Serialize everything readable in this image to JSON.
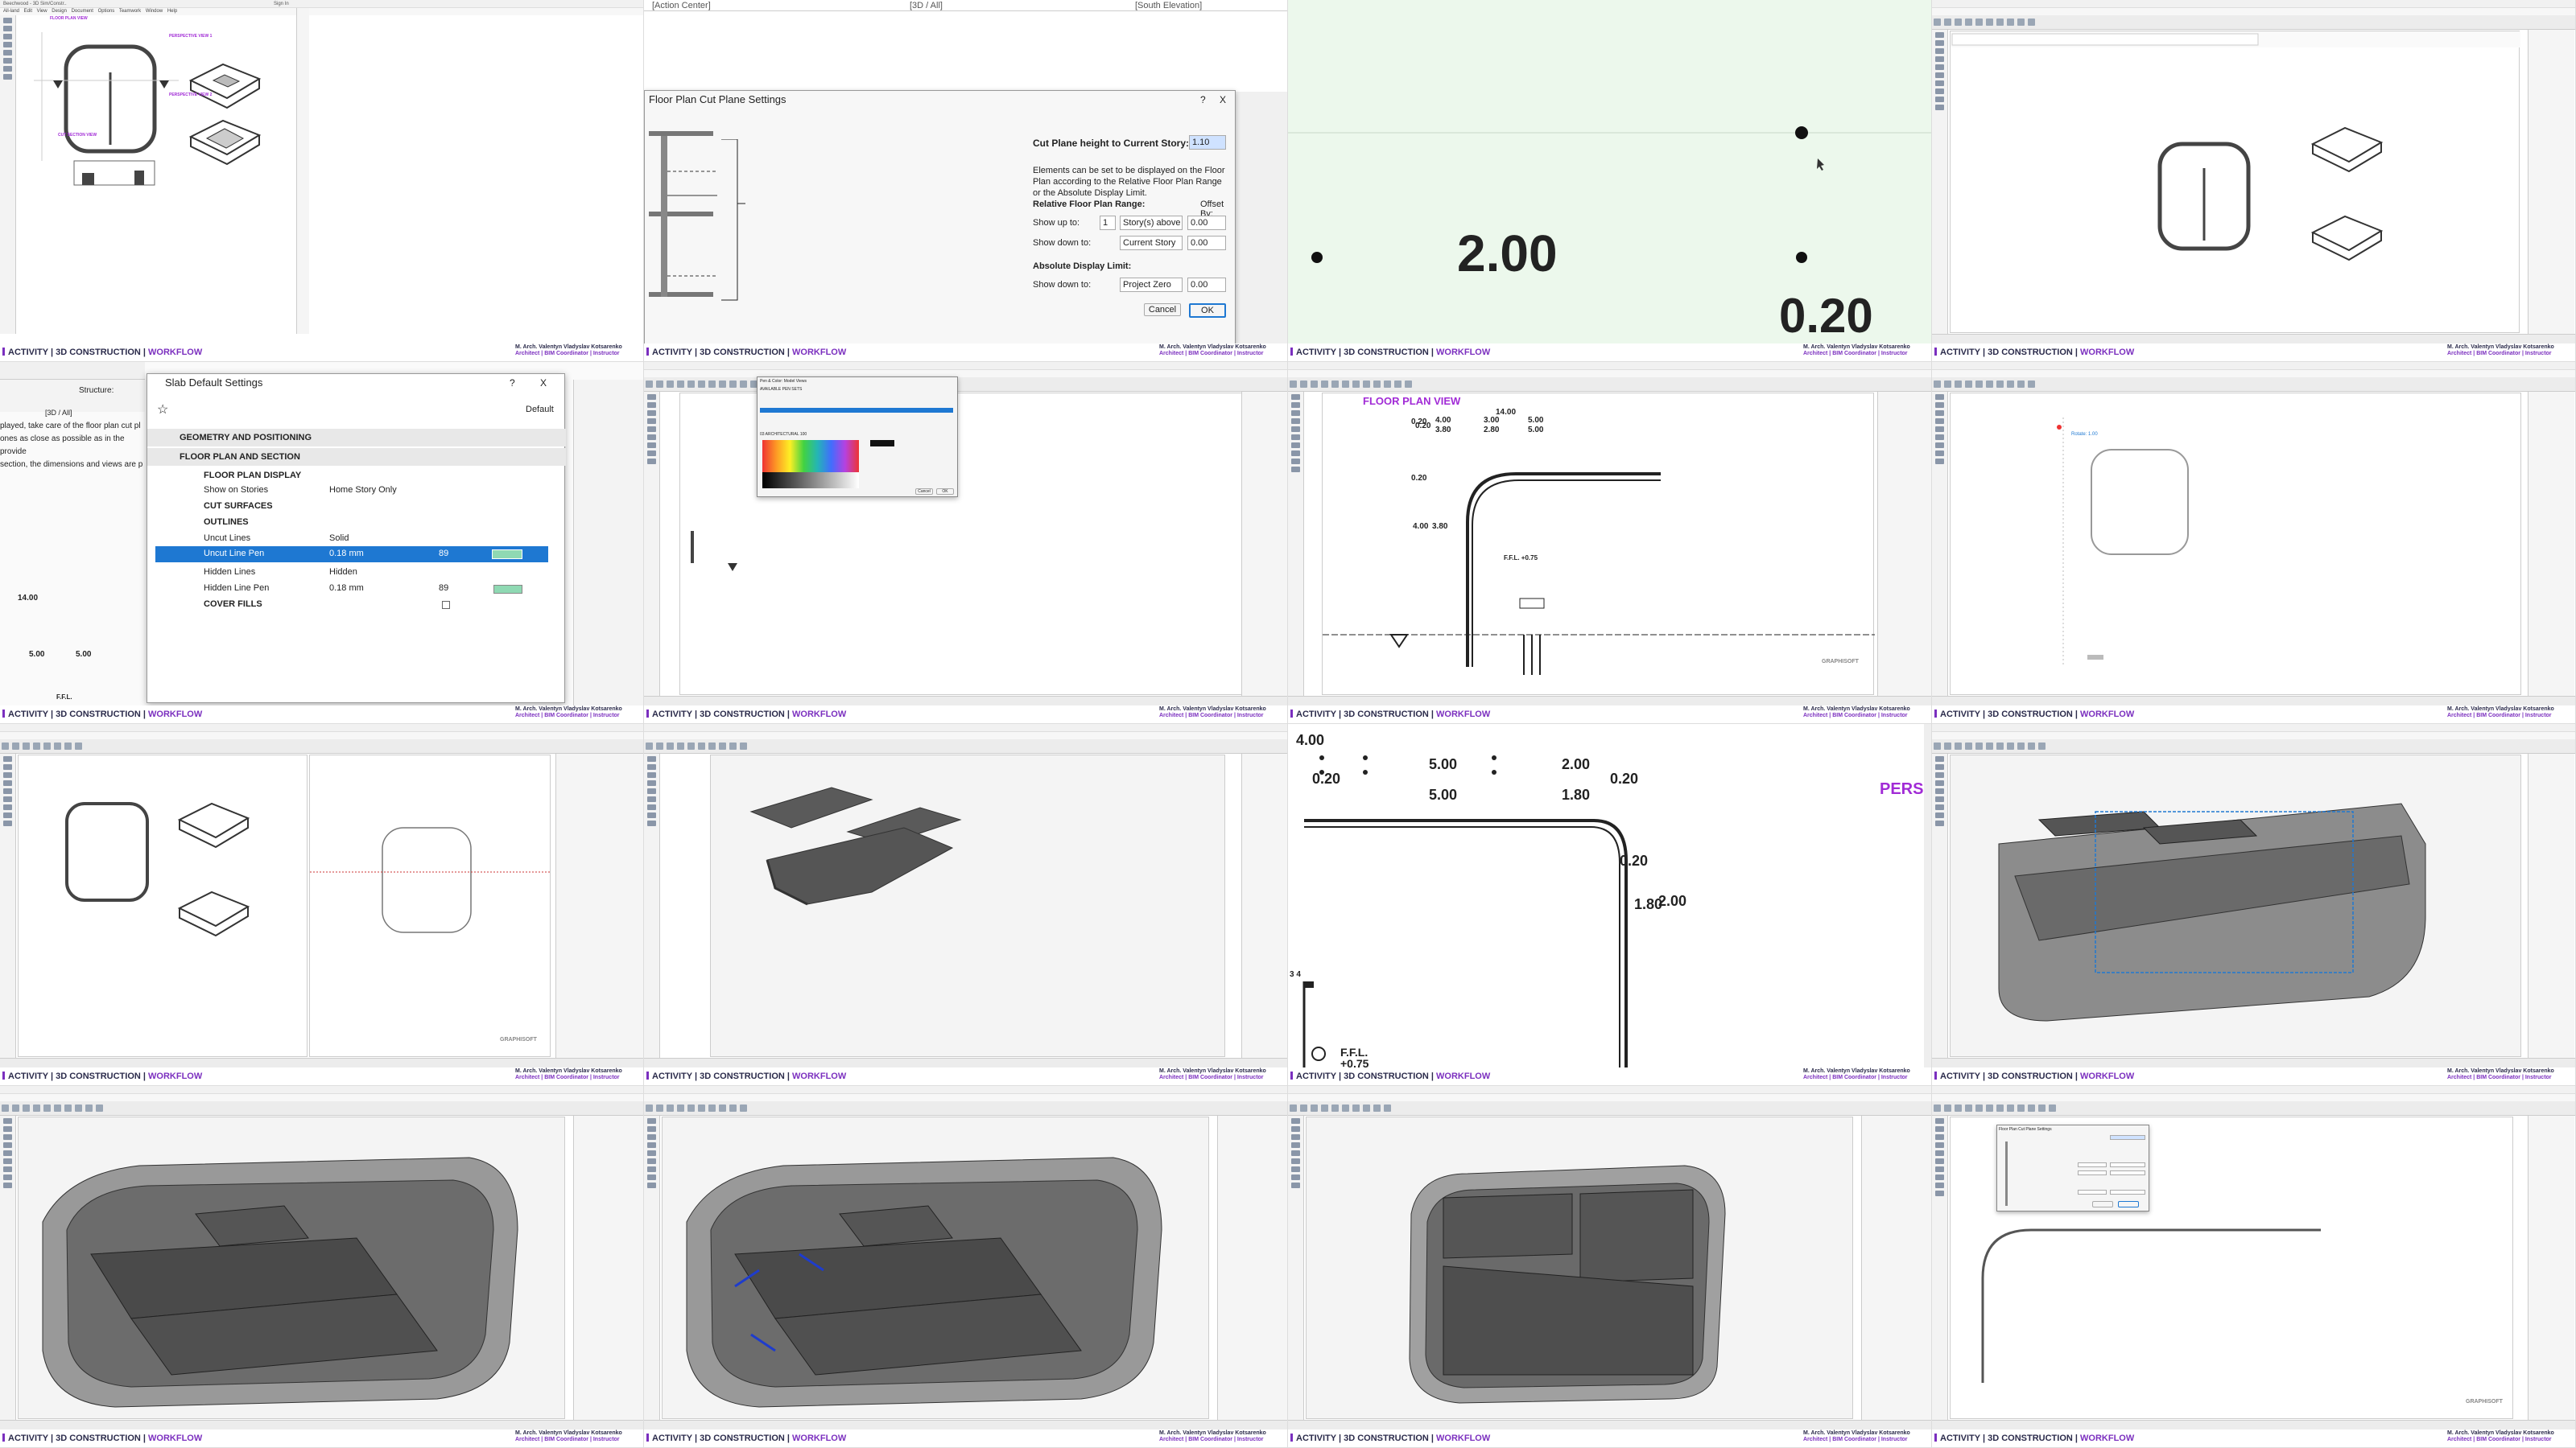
{
  "footer": {
    "activity": "ACTIVITY | 3D CONSTRUCTION |",
    "workflow": "WORKFLOW",
    "author": "M. Arch. Valentyn Vladyslav Kotsarenko",
    "role": "Architect | BIM Coordinator | Instructor"
  },
  "tile1": {
    "win_tab": "Beechwood - 3D Sim/Constr..",
    "title": "Sign In",
    "menu": "All-land  Edit  View  Design  Document  Options  Teamwork  Window  Help",
    "labels": {
      "plan": "FLOOR PLAN VIEW",
      "persp1": "PERSPECTIVE VIEW 1",
      "persp2": "PERSPECTIVE VIEW 2",
      "section": "CUT SECTION VIEW"
    }
  },
  "tile2": {
    "top_tabs": [
      "[Action Center]",
      "[3D / All]",
      "[South Elevation]"
    ],
    "title": "Floor Plan Cut Plane Settings",
    "help": "?",
    "close": "X",
    "cut_height_label": "Cut Plane height to Current Story:",
    "cut_height_value": "1.10",
    "desc": "Elements can be set to be displayed on the Floor Plan according to the Relative Floor Plan Range or the Absolute Display Limit.",
    "rel_range": "Relative Floor Plan Range:",
    "offset_by": "Offset By:",
    "show_up": "Show up to:",
    "show_up_n": "1",
    "show_up_sel": "Story(s) above",
    "show_up_val": "0.00",
    "show_down": "Show down to:",
    "show_down_sel": "Current Story",
    "show_down_val": "0.00",
    "abs_limit": "Absolute Display Limit:",
    "abs_down": "Show down to:",
    "abs_sel": "Project Zero",
    "abs_val": "0.00",
    "cancel": "Cancel",
    "ok": "OK"
  },
  "tile3": {
    "big": "2.00",
    "small": "0.20"
  },
  "tile5": {
    "title": "Slab Default Settings",
    "help": "?",
    "close": "X",
    "default": "Default",
    "sections": [
      "GEOMETRY AND POSITIONING",
      "FLOOR PLAN AND SECTION"
    ],
    "fp_display": "FLOOR PLAN DISPLAY",
    "show_on": "Show on Stories",
    "show_on_val": "Home Story Only",
    "cut_surfaces": "CUT SURFACES",
    "outlines": "OUTLINES",
    "rows": [
      {
        "label": "Uncut Lines",
        "value": "Solid"
      },
      {
        "label": "Uncut Line Pen",
        "value": "0.18 mm",
        "pen": "89"
      },
      {
        "label": "Hidden Lines",
        "value": "Hidden"
      },
      {
        "label": "Hidden Line Pen",
        "value": "0.18 mm",
        "pen": "89"
      }
    ],
    "cover_fills": "COVER FILLS",
    "left_text": [
      "played, take care of the floor plan cut pl",
      "ones as close as possible as in the provide",
      "section, the dimensions and views are p"
    ],
    "left_3d": "[3D / All]",
    "struct": "Structure:",
    "dim_vals": [
      "14.00",
      "5.00",
      "5.00"
    ],
    "ffl": "F.F.L."
  },
  "tile6": {
    "dialog": "Pen & Color: Model Views",
    "avail": "AVAILABLE PEN SETS",
    "pen_set": "03 ARCHITECTURAL 100",
    "cancel": "Cancel",
    "ok": "OK"
  },
  "tile7": {
    "plan_label": "FLOOR PLAN VIEW",
    "dims": [
      "4.00",
      "3.00",
      "5.00",
      "14.00",
      "5.00",
      "3.80",
      "2.80",
      "0.20",
      "0.20",
      "0.20",
      "4.00",
      "3.80"
    ],
    "ffl": "F.F.L. +0.75"
  },
  "tile8": {
    "label": "Rotate: 1.00"
  },
  "tile12": {
    "dims": [
      "4.00",
      "5.00",
      "2.00",
      "0.20",
      "5.00",
      "1.80",
      "0.20",
      "0.20",
      "1.80",
      "2.00"
    ],
    "persp": "PERSPI",
    "ffl": "F.F.L.",
    "ffl_val": "+0.75",
    "stair": "3 4"
  },
  "tile16": {
    "dialog": "Floor Plan Cut Plane Settings"
  },
  "watermark": "GRAPHISOFT",
  "colors": {
    "accent": "#7b2fbf",
    "label_purple": "#a12bd6",
    "slab": "#5a5a5a",
    "slab_light": "#8c8c8c",
    "select": "#1e78d2"
  }
}
